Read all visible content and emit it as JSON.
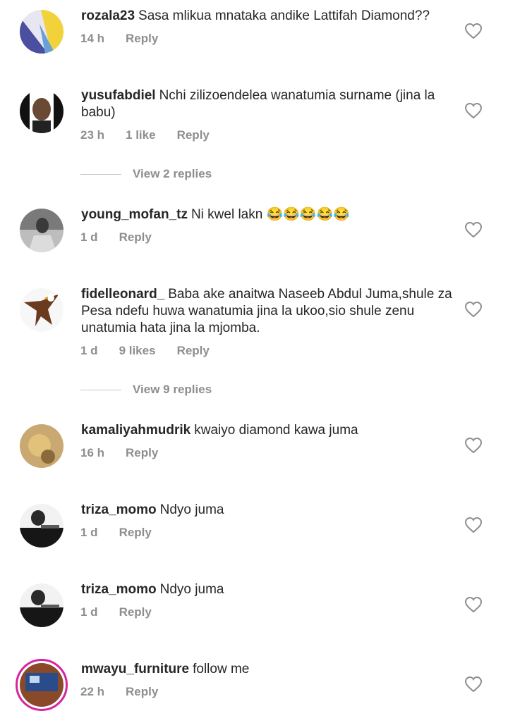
{
  "comments": [
    {
      "username": "rozala23",
      "text": "Sasa mlikua mnataka andike Lattifah Diamond??",
      "time": "14 h",
      "likes": "",
      "reply": "Reply"
    },
    {
      "username": "yusufabdiel",
      "text": "Nchi zilizoendelea wanatumia surname (jina la babu)",
      "time": "23 h",
      "likes": "1 like",
      "reply": "Reply",
      "view_replies": "View 2 replies"
    },
    {
      "username": "young_mofan_tz",
      "text": "Ni kwel lakn 😂😂😂😂😂",
      "time": "1 d",
      "likes": "",
      "reply": "Reply"
    },
    {
      "username": "fidelleonard_",
      "text": "Baba ake anaitwa Naseeb Abdul Juma,shule za Pesa ndefu huwa wanatumia jina la ukoo,sio shule zenu unatumia hata jina la mjomba.",
      "time": "1 d",
      "likes": "9 likes",
      "reply": "Reply",
      "view_replies": "View 9 replies"
    },
    {
      "username": "kamaliyahmudrik",
      "text": "kwaiyo diamond kawa juma",
      "time": "16 h",
      "likes": "",
      "reply": "Reply"
    },
    {
      "username": "triza_momo",
      "text": "Ndyo juma",
      "time": "1 d",
      "likes": "",
      "reply": "Reply"
    },
    {
      "username": "triza_momo",
      "text": "Ndyo juma",
      "time": "1 d",
      "likes": "",
      "reply": "Reply"
    },
    {
      "username": "mwayu_furniture",
      "text": "follow me",
      "time": "22 h",
      "likes": "",
      "reply": "Reply"
    }
  ]
}
